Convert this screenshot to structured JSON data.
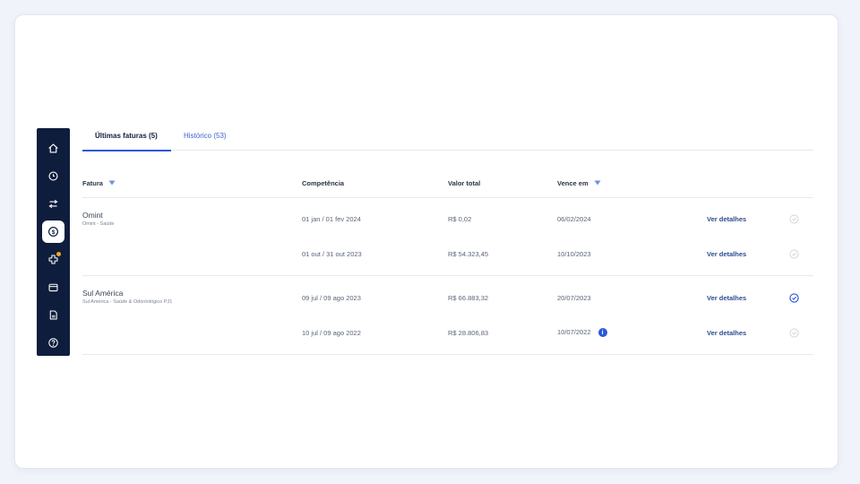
{
  "tabs": [
    {
      "label": "Últimas faturas (5)",
      "active": true
    },
    {
      "label": "Histórico (53)",
      "active": false
    }
  ],
  "table": {
    "headers": {
      "fatura": "Fatura",
      "competencia": "Competência",
      "valor": "Valor total",
      "vence": "Vence em"
    },
    "groups": [
      {
        "provider": "Omint",
        "plan": "Omint - Saúde",
        "rows": [
          {
            "competencia": "01 jan / 01 fev 2024",
            "valor": "R$ 0,02",
            "vence": "06/02/2024",
            "action": "Ver detalhes",
            "status": "pending"
          },
          {
            "competencia": "01 out / 31 out 2023",
            "valor": "R$ 54.323,45",
            "vence": "10/10/2023",
            "action": "Ver detalhes",
            "status": "pending"
          }
        ]
      },
      {
        "provider": "Sul América",
        "plan": "Sul América - Saúde & Odontológico PJ1",
        "rows": [
          {
            "competencia": "09 jul / 09 ago 2023",
            "valor": "R$ 66.883,32",
            "vence": "20/07/2023",
            "action": "Ver detalhes",
            "status": "active"
          },
          {
            "competencia": "10 jul / 09 ago 2022",
            "valor": "R$ 28.806,83",
            "vence": "10/07/2022",
            "action": "Ver detalhes",
            "status": "pending",
            "info": "i"
          }
        ]
      }
    ]
  },
  "sidebar": {
    "items": [
      {
        "icon": "home-icon"
      },
      {
        "icon": "clock-icon"
      },
      {
        "icon": "transfer-icon"
      },
      {
        "icon": "dollar-icon",
        "active": true
      },
      {
        "icon": "health-cross-icon",
        "badge": true
      },
      {
        "icon": "wallet-icon"
      },
      {
        "icon": "document-icon"
      },
      {
        "icon": "help-icon"
      }
    ]
  },
  "colors": {
    "accent": "#2a57d8",
    "sidebar": "#0f1d3d",
    "badge": "#f5a623"
  }
}
